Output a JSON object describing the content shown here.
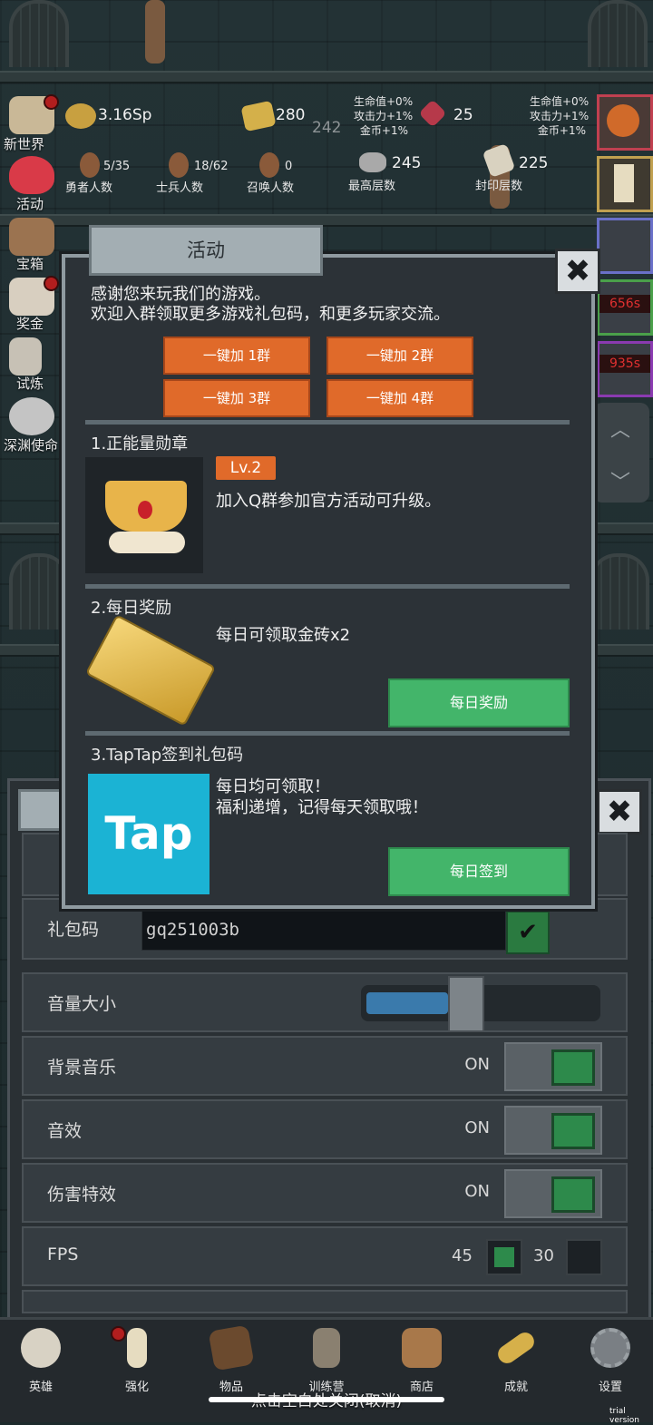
{
  "hud": {
    "gold": "3.16Sp",
    "bricks": "280",
    "bricks_sub": "242",
    "gems": "25",
    "bonus_left": [
      "生命值+0%",
      "攻击力+1%",
      "金币+1%"
    ],
    "bonus_right": [
      "生命值+0%",
      "攻击力+1%",
      "金币+1%"
    ],
    "heroes_count": "5/35",
    "heroes_label": "勇者人数",
    "soldiers_count": "18/62",
    "soldiers_label": "士兵人数",
    "summon_count": "0",
    "summon_label": "召唤人数",
    "max_floor": "245",
    "max_floor_label": "最高层数",
    "sealed_floor": "225",
    "sealed_floor_label": "封印层数"
  },
  "sidebar": {
    "items": [
      {
        "label": "新世界"
      },
      {
        "label": "活动"
      },
      {
        "label": "宝箱"
      },
      {
        "label": "奖金"
      },
      {
        "label": "试炼"
      },
      {
        "label": "深渊使命"
      }
    ]
  },
  "right_timers": [
    "656s",
    "935s"
  ],
  "modal": {
    "title": "活动",
    "close": "✖",
    "intro": [
      "感谢您来玩我们的游戏。",
      "欢迎入群领取更多游戏礼包码，和更多玩家交流。"
    ],
    "group_buttons": [
      "一键加 1群",
      "一键加 2群",
      "一键加 3群",
      "一键加 4群"
    ],
    "section1": {
      "title": "1.正能量勋章",
      "level": "Lv.2",
      "desc": "加入Q群参加官方活动可升级。"
    },
    "section2": {
      "title": "2.每日奖励",
      "desc": "每日可领取金砖x2",
      "button": "每日奖励"
    },
    "section3": {
      "title": "3.TapTap签到礼包码",
      "desc": [
        "每日均可领取！",
        "福利递增，记得每天领取哦！"
      ],
      "logo": "Tap",
      "button": "每日签到"
    }
  },
  "settings": {
    "close": "✖",
    "gift_code_label": "礼包码",
    "gift_code_value": "gq251003b",
    "volume_label": "音量大小",
    "volume_level": 0.34,
    "bgm_label": "背景音乐",
    "bgm_state": "ON",
    "sfx_label": "音效",
    "sfx_state": "ON",
    "damage_label": "伤害特效",
    "damage_state": "ON",
    "fps_label": "FPS",
    "fps_opt1": "45",
    "fps_opt2": "30"
  },
  "nav": {
    "items": [
      {
        "label": "英雄"
      },
      {
        "label": "强化"
      },
      {
        "label": "物品"
      },
      {
        "label": "训练营"
      },
      {
        "label": "商店"
      },
      {
        "label": "成就"
      },
      {
        "label": "设置"
      }
    ],
    "hint": "点击空白处关闭(取消)",
    "watermark": "trial version"
  },
  "colors": {
    "accent_orange": "#e06a2a",
    "accent_green": "#43b56a",
    "tap_blue": "#1bb3d4",
    "toggle_on": "#2d8a4b"
  }
}
